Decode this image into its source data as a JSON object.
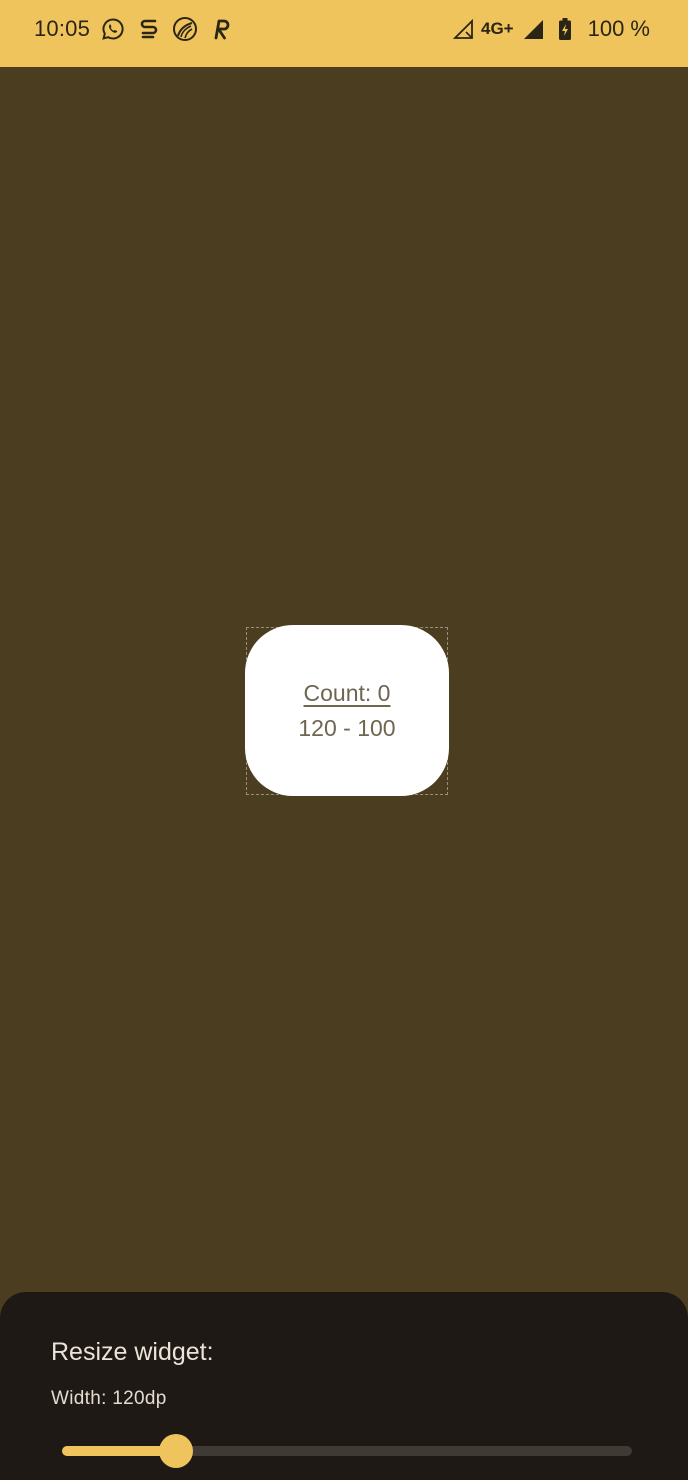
{
  "colors": {
    "status_bar": "#f0c45c",
    "background": "#4b3d1f",
    "sheet": "#1e1915",
    "accent": "#f0c45c",
    "widget_text": "#6e6650"
  },
  "status_bar": {
    "time": "10:05",
    "app_icons": [
      "whatsapp-icon",
      "s-app-icon",
      "leaf-app-icon",
      "r-app-icon"
    ],
    "network_label": "4G+",
    "battery_percent": "100 %"
  },
  "widget": {
    "count_text": "Count: 0",
    "size_text": "120 - 100"
  },
  "sheet": {
    "title": "Resize widget:",
    "width_label": "Width: 120dp"
  },
  "slider": {
    "value_fraction": 0.2
  }
}
